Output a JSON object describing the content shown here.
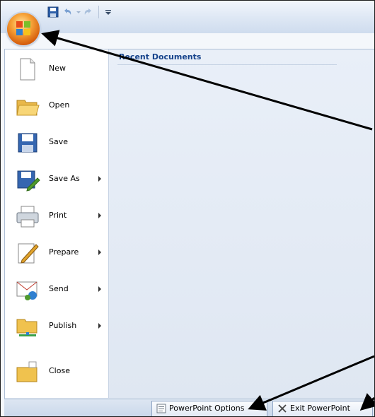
{
  "recent_documents": {
    "title": "Recent Documents"
  },
  "menu": {
    "items": [
      {
        "label": "New",
        "icon": "new-document-icon",
        "has_submenu": false
      },
      {
        "label": "Open",
        "icon": "open-folder-icon",
        "has_submenu": false
      },
      {
        "label": "Save",
        "icon": "floppy-disk-icon",
        "has_submenu": false
      },
      {
        "label": "Save As",
        "icon": "save-as-icon",
        "has_submenu": true
      },
      {
        "label": "Print",
        "icon": "printer-icon",
        "has_submenu": true
      },
      {
        "label": "Prepare",
        "icon": "prepare-pen-icon",
        "has_submenu": true
      },
      {
        "label": "Send",
        "icon": "send-icon",
        "has_submenu": true
      },
      {
        "label": "Publish",
        "icon": "publish-icon",
        "has_submenu": true
      },
      {
        "label": "Close",
        "icon": "close-folder-icon",
        "has_submenu": false
      }
    ]
  },
  "footer": {
    "options_label": "PowerPoint Options",
    "exit_label": "Exit PowerPoint"
  },
  "colors": {
    "accent": "#15428b",
    "office_orange": "#f7a43a",
    "annotation_arrow": "#000000"
  }
}
